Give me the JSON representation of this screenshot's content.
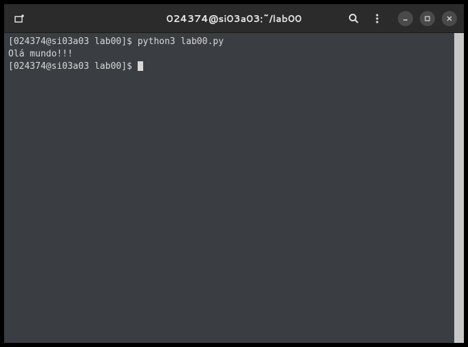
{
  "titlebar": {
    "title": "024374@si03a03:~/lab00"
  },
  "terminal": {
    "lines": [
      {
        "prompt": "[024374@si03a03 lab00]$ ",
        "command": "python3 lab00.py"
      },
      {
        "output": "Olá mundo!!!"
      },
      {
        "prompt": "[024374@si03a03 lab00]$ ",
        "cursor": true
      }
    ]
  },
  "colors": {
    "titlebar_bg": "#2b2b2b",
    "terminal_bg": "#3a3e42",
    "text": "#d8d8d8"
  }
}
